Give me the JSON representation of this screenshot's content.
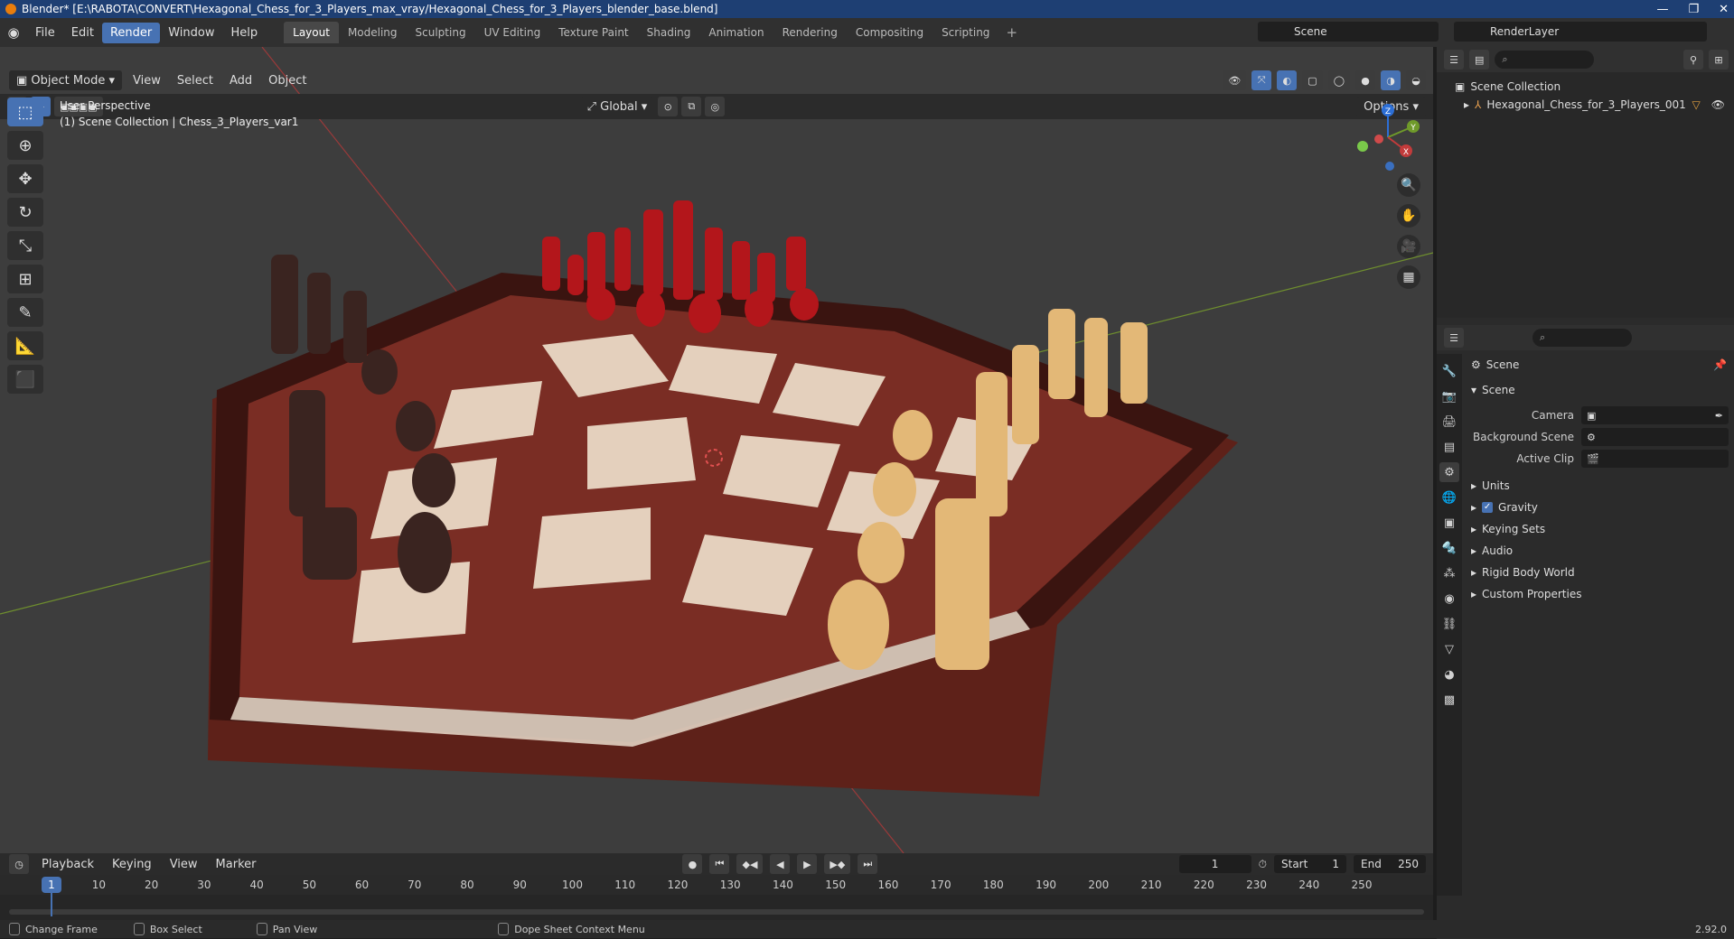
{
  "window": {
    "title": "Blender* [E:\\RABOTA\\CONVERT\\Hexagonal_Chess_for_3_Players_max_vray/Hexagonal_Chess_for_3_Players_blender_base.blend]",
    "controls": [
      "—",
      "❐",
      "✕"
    ]
  },
  "menu": {
    "items": [
      "File",
      "Edit",
      "Render",
      "Window",
      "Help"
    ],
    "active": "Render"
  },
  "workspaces": [
    "Layout",
    "Modeling",
    "Sculpting",
    "UV Editing",
    "Texture Paint",
    "Shading",
    "Animation",
    "Rendering",
    "Compositing",
    "Scripting"
  ],
  "workspace_plus": "+",
  "scene_selector": {
    "value": "Scene"
  },
  "renderlayer_selector": {
    "value": "RenderLayer"
  },
  "viewport": {
    "transform_orientation": "Global",
    "options_label": "Options",
    "mode": "Object Mode",
    "header_menus": [
      "View",
      "Select",
      "Add",
      "Object"
    ],
    "info_line1": "User Perspective",
    "info_line2": "(1) Scene Collection | Chess_3_Players_var1"
  },
  "gizmo": {
    "z": "Z",
    "y": "Y",
    "x": "X"
  },
  "outliner": {
    "root": "Scene Collection",
    "item": "Hexagonal_Chess_for_3_Players_001"
  },
  "properties": {
    "context": "Scene",
    "panel": "Scene",
    "camera_label": "Camera",
    "bg_scene_label": "Background Scene",
    "active_clip_label": "Active Clip",
    "sections": [
      "Units",
      "Gravity",
      "Keying Sets",
      "Audio",
      "Rigid Body World",
      "Custom Properties"
    ]
  },
  "timeline": {
    "menus": [
      "Playback",
      "Keying",
      "View",
      "Marker"
    ],
    "current_frame": "1",
    "start_label": "Start",
    "start": "1",
    "end_label": "End",
    "end": "250",
    "ticks": [
      "10",
      "20",
      "30",
      "40",
      "50",
      "60",
      "70",
      "80",
      "90",
      "100",
      "110",
      "120",
      "130",
      "140",
      "150",
      "160",
      "170",
      "180",
      "190",
      "200",
      "210",
      "220",
      "230",
      "240",
      "250"
    ],
    "cursor": "1"
  },
  "status_bar": {
    "change_frame": "Change Frame",
    "box_select": "Box Select",
    "pan_view": "Pan View",
    "context_menu": "Dope Sheet Context Menu",
    "version": "2.92.0"
  },
  "colors": {
    "accent": "#4772b3",
    "titlebar": "#1e3f73",
    "red_pieces": "#b3161b",
    "dark_pieces": "#3a2420",
    "light_pieces": "#e3b877",
    "board_dark": "#6b2a22",
    "board_light": "#e9dccd"
  }
}
